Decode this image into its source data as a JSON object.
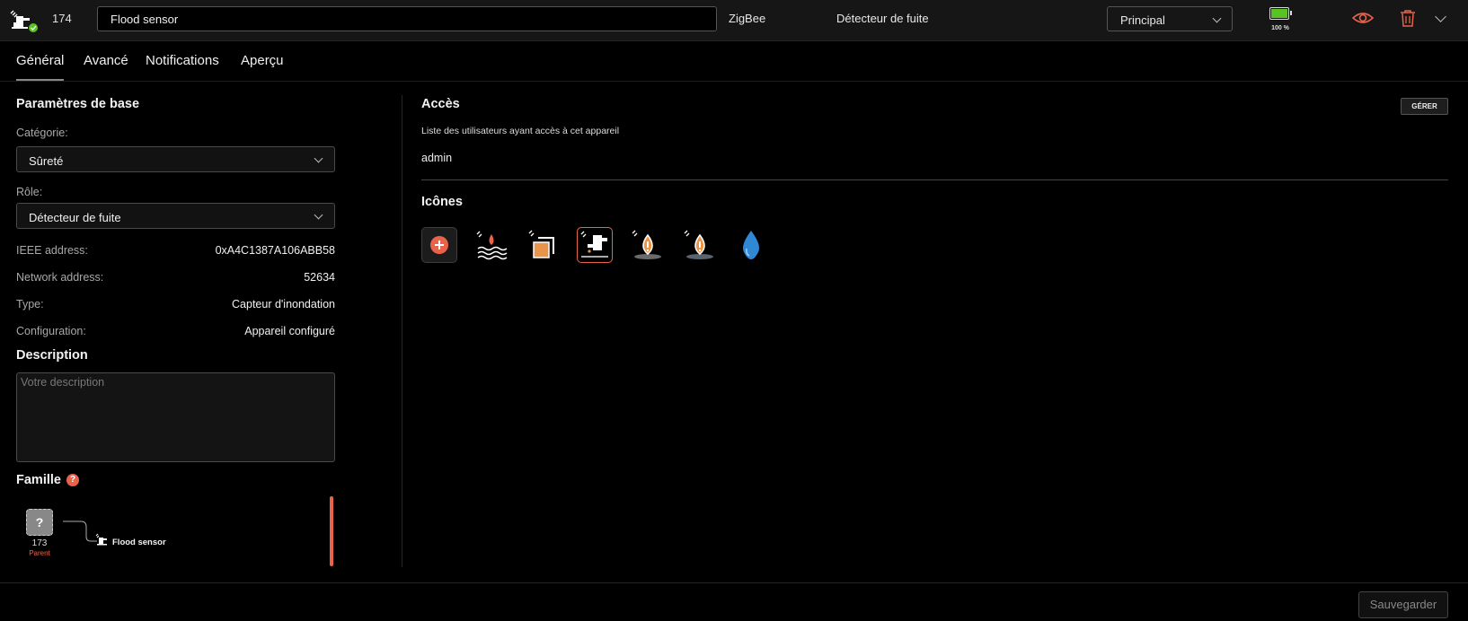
{
  "header": {
    "device_id": "174",
    "device_name": "Flood sensor",
    "protocol": "ZigBee",
    "role": "Détecteur de fuite",
    "zone": "Principal",
    "battery_level": "100 %",
    "battery_fraction": 1.0,
    "icons": [
      "device-icon",
      "status-ok-icon",
      "eye-icon",
      "trash-icon",
      "chevron-down-icon"
    ]
  },
  "tabs": [
    {
      "label": "Général",
      "active": true
    },
    {
      "label": "Avancé"
    },
    {
      "label": "Notifications"
    },
    {
      "label": "Aperçu"
    }
  ],
  "basic": {
    "title": "Paramètres de base",
    "category_label": "Catégorie:",
    "category_value": "Sûreté",
    "role_label": "Rôle:",
    "role_value": "Détecteur de fuite",
    "info": [
      {
        "label": "IEEE address:",
        "value": "0xA4C1387A106ABB58"
      },
      {
        "label": "Network address:",
        "value": "52634"
      },
      {
        "label": "Type:",
        "value": "Capteur d'inondation"
      },
      {
        "label": "Configuration:",
        "value": "Appareil configuré"
      }
    ]
  },
  "description": {
    "title": "Description",
    "placeholder": "Votre description"
  },
  "family": {
    "title": "Famille",
    "help_icon": "?",
    "parent_id": "173",
    "parent_label": "Parent",
    "parent_glyph": "?",
    "child_name": "Flood sensor"
  },
  "access": {
    "title": "Accès",
    "manage_label": "GÉRER",
    "description": "Liste des utilisateurs ayant accès à cet appareil",
    "users": [
      "admin"
    ]
  },
  "icons_section": {
    "title": "Icônes",
    "icons": [
      "add-icon",
      "water-waves-icon",
      "square-sensor-icon",
      "faucet-leak-icon",
      "drop-puddle-icon",
      "drop-puddle-alt-icon",
      "water-drop-icon"
    ],
    "selected": "faucet-leak-icon"
  },
  "footer": {
    "save_label": "Sauvegarder"
  },
  "colors": {
    "accent": "#e8634a",
    "battery": "#58c322",
    "background": "#000000",
    "header_bg": "#161616"
  }
}
